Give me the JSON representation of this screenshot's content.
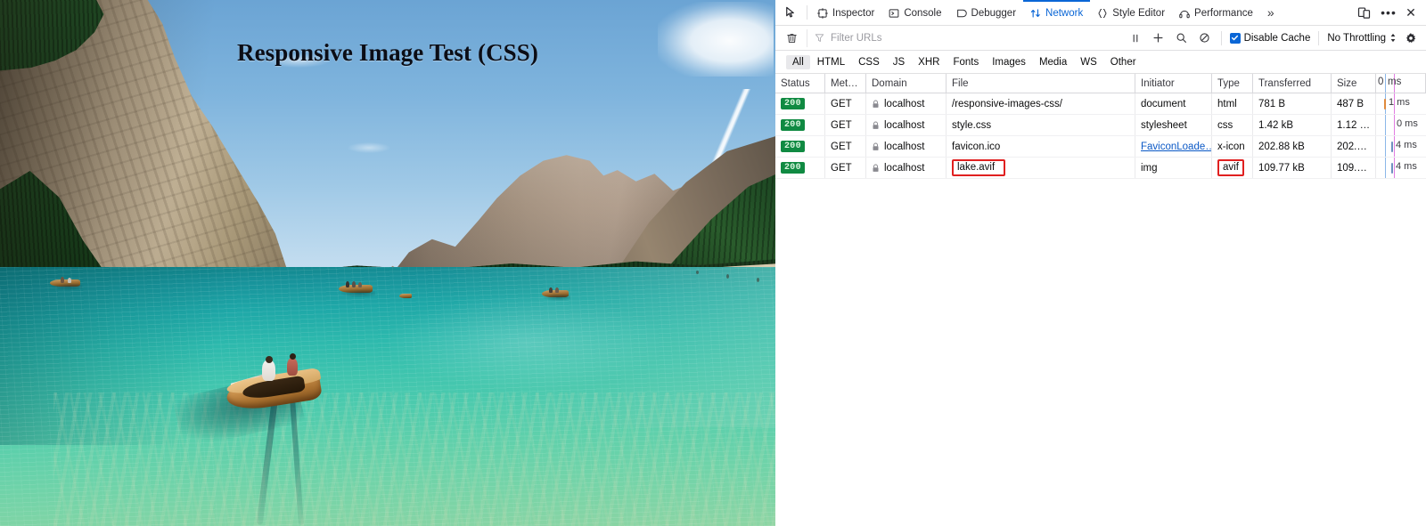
{
  "page": {
    "title": "Responsive Image Test (CSS)",
    "image_alt": "Aerial photo of a turquoise alpine lake with a wooden rowing boat, forested slopes and dolomite peaks"
  },
  "devtools": {
    "toolbar": {
      "picker_icon": "element-picker-icon",
      "tabs": [
        {
          "label": "Inspector",
          "icon": "inspector-icon",
          "active": false
        },
        {
          "label": "Console",
          "icon": "console-icon",
          "active": false
        },
        {
          "label": "Debugger",
          "icon": "debugger-icon",
          "active": false
        },
        {
          "label": "Network",
          "icon": "network-icon",
          "active": true
        },
        {
          "label": "Style Editor",
          "icon": "style-editor-icon",
          "active": false
        },
        {
          "label": "Performance",
          "icon": "performance-icon",
          "active": false
        }
      ],
      "overflow_label": "»",
      "responsive_mode_icon": "responsive-design-mode-icon",
      "meatball_label": "•••",
      "close_label": "✕"
    },
    "filterbar": {
      "clear_icon": "trash-icon",
      "filter_icon": "funnel-icon",
      "filter_value": "",
      "filter_placeholder": "Filter URLs",
      "pause_icon": "pause-icon",
      "new_request_icon": "plus-icon",
      "search_icon": "magnifier-icon",
      "block_icon": "block-icon",
      "disable_cache_label": "Disable Cache",
      "disable_cache_checked": true,
      "throttle_value": "No Throttling",
      "settings_icon": "gear-icon",
      "accent_color": "#0a66d6"
    },
    "type_filters": [
      {
        "label": "All",
        "active": true
      },
      {
        "label": "HTML",
        "active": false
      },
      {
        "label": "CSS",
        "active": false
      },
      {
        "label": "JS",
        "active": false
      },
      {
        "label": "XHR",
        "active": false
      },
      {
        "label": "Fonts",
        "active": false
      },
      {
        "label": "Images",
        "active": false
      },
      {
        "label": "Media",
        "active": false
      },
      {
        "label": "WS",
        "active": false
      },
      {
        "label": "Other",
        "active": false
      }
    ],
    "table": {
      "columns": {
        "status": "Status",
        "method": "Met…",
        "domain": "Domain",
        "file": "File",
        "initiator": "Initiator",
        "type": "Type",
        "transferred": "Transferred",
        "size": "Size",
        "waterfall_origin": "0",
        "waterfall_unit": "ms"
      },
      "rows": [
        {
          "status": "200",
          "method": "GET",
          "domain": "localhost",
          "secure": true,
          "file": "/responsive-images-css/",
          "file_highlighted": false,
          "initiator": "document",
          "initiator_link": false,
          "type": "html",
          "type_highlighted": false,
          "transferred": "781 B",
          "size": "487 B",
          "time": "1 ms",
          "tick_color": "#e08a3c"
        },
        {
          "status": "200",
          "method": "GET",
          "domain": "localhost",
          "secure": true,
          "file": "style.css",
          "file_highlighted": false,
          "initiator": "stylesheet",
          "initiator_link": false,
          "type": "css",
          "type_highlighted": false,
          "transferred": "1.42 kB",
          "size": "1.12 …",
          "time": "0 ms",
          "tick_color": "#8bb7e8"
        },
        {
          "status": "200",
          "method": "GET",
          "domain": "localhost",
          "secure": true,
          "file": "favicon.ico",
          "file_highlighted": false,
          "initiator": "FaviconLoade…",
          "initiator_link": true,
          "type": "x-icon",
          "type_highlighted": false,
          "transferred": "202.88 kB",
          "size": "202.…",
          "time": "4 ms",
          "tick_color": "#6f8fbf"
        },
        {
          "status": "200",
          "method": "GET",
          "domain": "localhost",
          "secure": true,
          "file": "lake.avif",
          "file_highlighted": true,
          "initiator": "img",
          "initiator_link": false,
          "type": "avif",
          "type_highlighted": true,
          "transferred": "109.77 kB",
          "size": "109.…",
          "time": "4 ms",
          "tick_color": "#6f8fbf"
        }
      ],
      "highlight_color": "#e02020",
      "status_badge_color": "#108a42"
    }
  }
}
